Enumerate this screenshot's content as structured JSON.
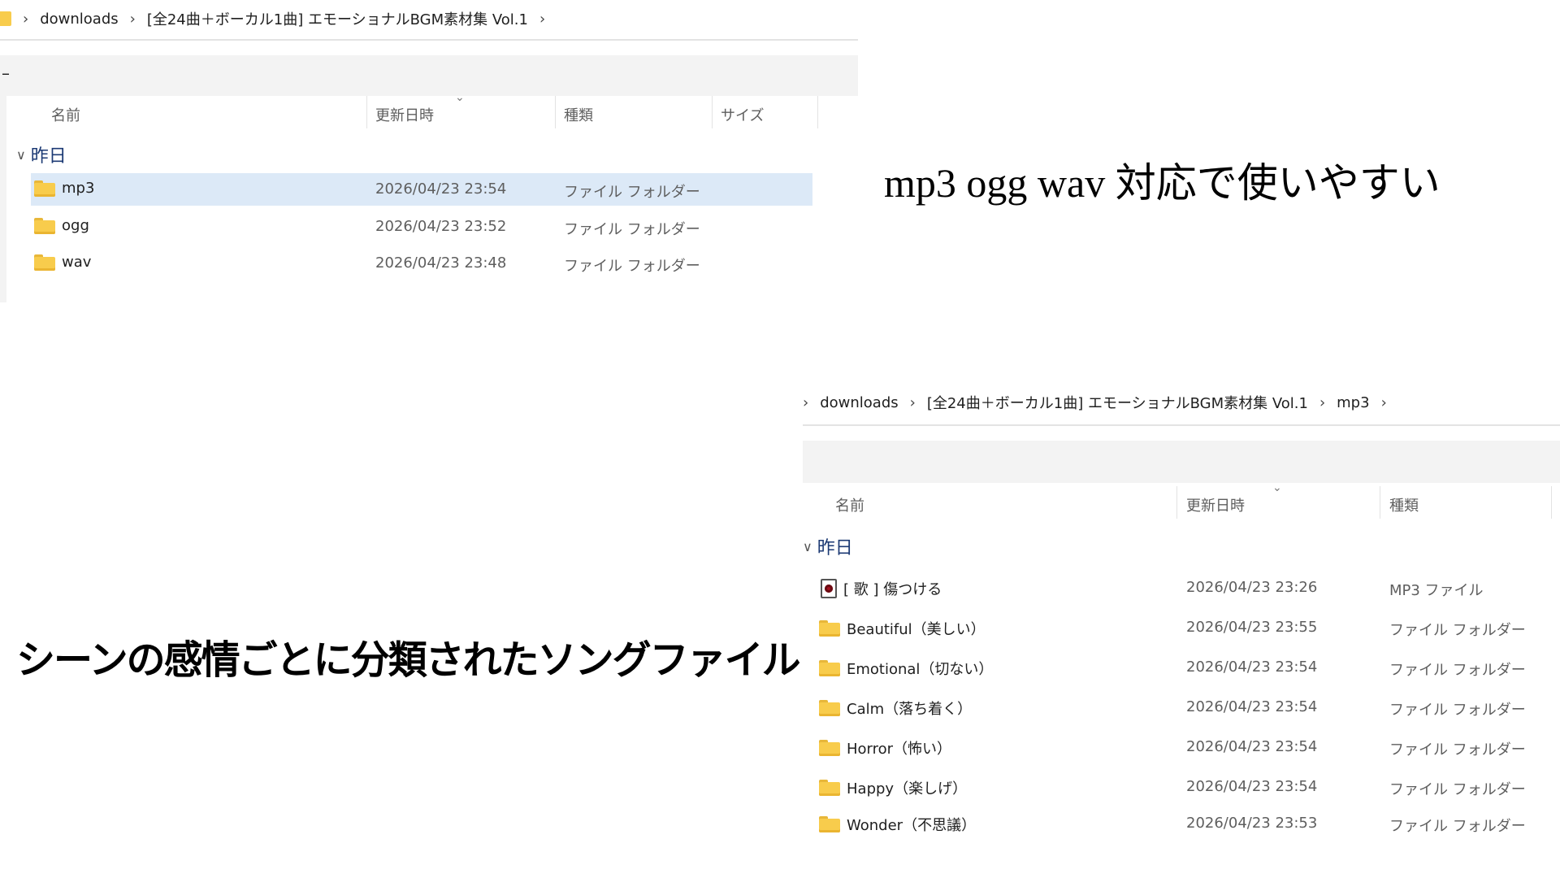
{
  "top_explorer": {
    "breadcrumb": [
      "downloads",
      "[全24曲＋ボーカル1曲] エモーショナルBGM素材集 Vol.1"
    ],
    "toolbar_mark": "–",
    "columns": {
      "name": "名前",
      "modified": "更新日時",
      "type": "種類",
      "size": "サイズ"
    },
    "group_label": "昨日",
    "rows": [
      {
        "name": "mp3",
        "modified": "2026/04/23 23:54",
        "type": "ファイル フォルダー",
        "selected": true
      },
      {
        "name": "ogg",
        "modified": "2026/04/23 23:52",
        "type": "ファイル フォルダー",
        "selected": false
      },
      {
        "name": "wav",
        "modified": "2026/04/23 23:48",
        "type": "ファイル フォルダー",
        "selected": false
      }
    ]
  },
  "headline_formats": "mp3 ogg wav 対応で使いやすい",
  "headline_categories": "シーンの感情ごとに分類されたソングファイル",
  "bottom_explorer": {
    "breadcrumb": [
      "downloads",
      "[全24曲＋ボーカル1曲] エモーショナルBGM素材集 Vol.1",
      "mp3"
    ],
    "columns": {
      "name": "名前",
      "modified": "更新日時",
      "type": "種類"
    },
    "group_label": "昨日",
    "rows": [
      {
        "icon": "mp3-file-icon",
        "name": "[ 歌 ] 傷つける",
        "modified": "2026/04/23 23:26",
        "type": "MP3 ファイル"
      },
      {
        "icon": "folder-icon",
        "name": "Beautiful（美しい）",
        "modified": "2026/04/23 23:55",
        "type": "ファイル フォルダー"
      },
      {
        "icon": "folder-icon",
        "name": "Emotional（切ない）",
        "modified": "2026/04/23 23:54",
        "type": "ファイル フォルダー"
      },
      {
        "icon": "folder-icon",
        "name": "Calm（落ち着く）",
        "modified": "2026/04/23 23:54",
        "type": "ファイル フォルダー"
      },
      {
        "icon": "folder-icon",
        "name": "Horror（怖い）",
        "modified": "2026/04/23 23:54",
        "type": "ファイル フォルダー"
      },
      {
        "icon": "folder-icon",
        "name": "Happy（楽しげ）",
        "modified": "2026/04/23 23:54",
        "type": "ファイル フォルダー"
      },
      {
        "icon": "folder-icon",
        "name": "Wonder（不思議）",
        "modified": "2026/04/23 23:53",
        "type": "ファイル フォルダー"
      }
    ]
  },
  "colors": {
    "selection": "#dce9f7",
    "folder": "#f8cc4c",
    "group_label": "#1c3a74"
  }
}
